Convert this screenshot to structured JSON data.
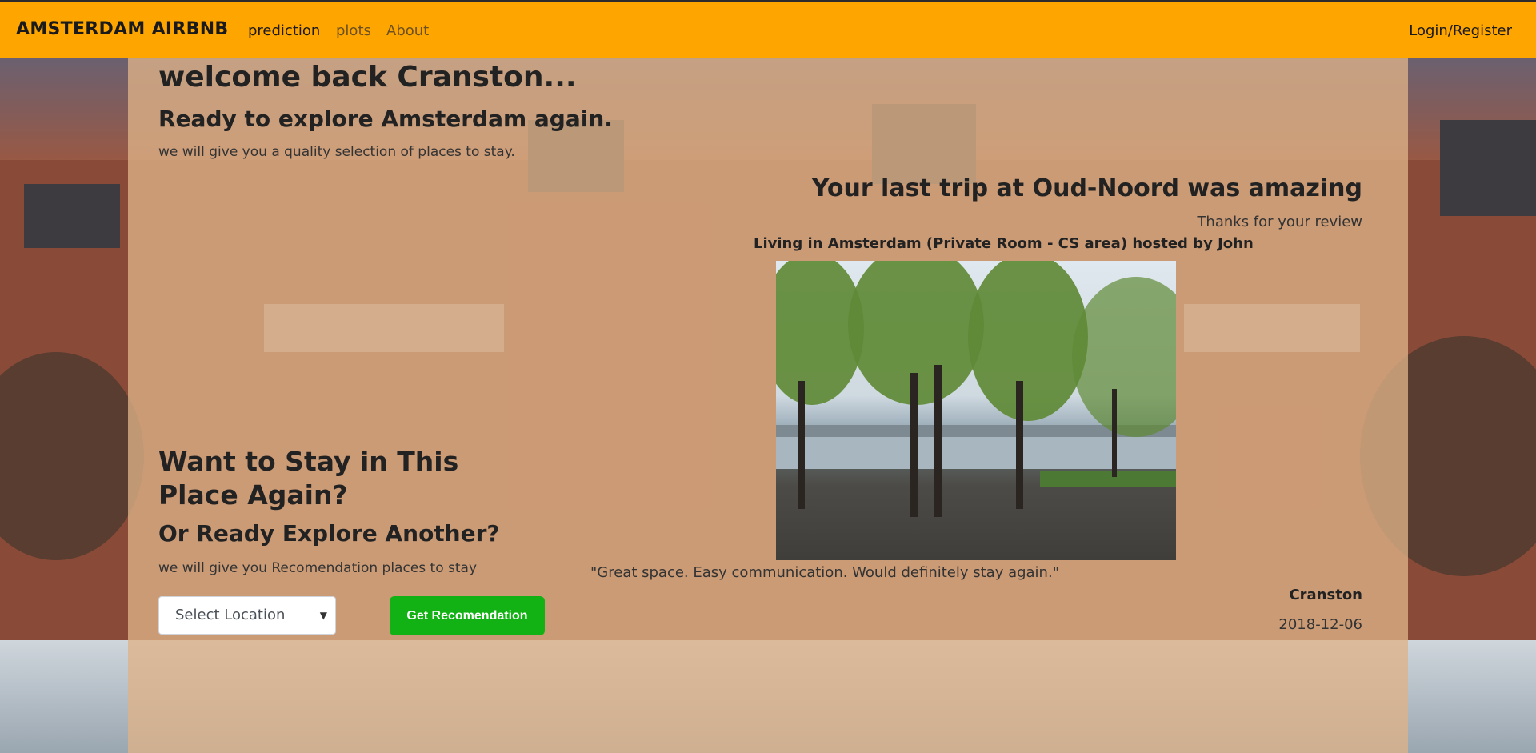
{
  "navbar": {
    "brand": "AMSTERDAM AIRBNB",
    "links": [
      "prediction",
      "plots",
      "About"
    ],
    "login": "Login/Register",
    "bg_color": "#ffa500"
  },
  "welcome": {
    "title": "welcome back Cranston...",
    "subtitle": "Ready to explore Amsterdam again.",
    "text": "we will give you a quality selection of places to stay."
  },
  "last_trip": {
    "title": "Your last trip at Oud-Noord was amazing",
    "thanks": "Thanks for your review",
    "listing": "Living in Amsterdam (Private Room - CS area) hosted by John",
    "photo": "listing-photo",
    "quote": "\"Great space. Easy communication. Would definitely stay again.\"",
    "author": "Cranston",
    "date": "2018-12-06"
  },
  "recommend": {
    "title": "Want to Stay in This Place Again?",
    "subtitle": "Or Ready Explore Another?",
    "text": "we will give you Recomendation places to stay",
    "select_value": "Select Location",
    "button_label": "Get Recomendation",
    "button_color": "#12b214"
  }
}
